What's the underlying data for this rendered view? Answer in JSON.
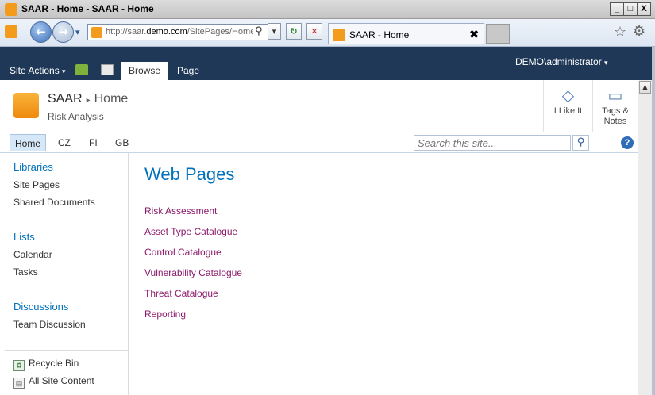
{
  "window": {
    "title": "SAAR - Home - SAAR - Home",
    "minimize_glyph": "_",
    "restore_glyph": "□",
    "close_glyph": "X"
  },
  "browser": {
    "back_glyph": "←",
    "forward_glyph": "→",
    "dropdown_glyph": "▾",
    "url_prefix": "http://saar.",
    "url_domain": "demo.com",
    "url_path": "/SitePages/Home",
    "search_glyph": "⚲",
    "addr_dropdown_glyph": "▾",
    "refresh_glyph": "↻",
    "stop_glyph": "✕",
    "tab_label": "SAAR - Home",
    "tab_close_glyph": "✖",
    "favorites_icon": "☆",
    "tools_icon": "⚙"
  },
  "ribbon": {
    "site_actions_label": "Site Actions",
    "site_actions_arrow": "▾",
    "tabs": [
      "Browse",
      "Page"
    ],
    "user_label": "DEMO\\administrator",
    "user_arrow": "▾"
  },
  "header": {
    "site_title": "SAAR",
    "breadcrumb_sep": "▸",
    "page_title": "Home",
    "site_description": "Risk Analysis",
    "i_like_it_label": "I Like It",
    "tags_notes_label_1": "Tags &",
    "tags_notes_label_2": "Notes"
  },
  "topnav": {
    "items": [
      "Home",
      "CZ",
      "FI",
      "GB"
    ],
    "search_placeholder": "Search this site...",
    "search_go_glyph": "⚲",
    "help_glyph": "?"
  },
  "leftnav": {
    "libraries_heading": "Libraries",
    "libraries": [
      "Site Pages",
      "Shared Documents"
    ],
    "lists_heading": "Lists",
    "lists": [
      "Calendar",
      "Tasks"
    ],
    "discussions_heading": "Discussions",
    "discussions": [
      "Team Discussion"
    ],
    "recycle_bin_label": "Recycle Bin",
    "all_site_content_label": "All Site Content"
  },
  "main": {
    "heading": "Web Pages",
    "links": [
      "Risk Assessment",
      "Asset Type Catalogue",
      "Control Catalogue",
      "Vulnerability Catalogue",
      "Threat Catalogue",
      "Reporting"
    ]
  },
  "colors": {
    "ribbon_bg": "#1f3857",
    "heading_blue": "#0072bc",
    "link_purple": "#8b1a6b",
    "logo_orange": "#f39b1c"
  }
}
